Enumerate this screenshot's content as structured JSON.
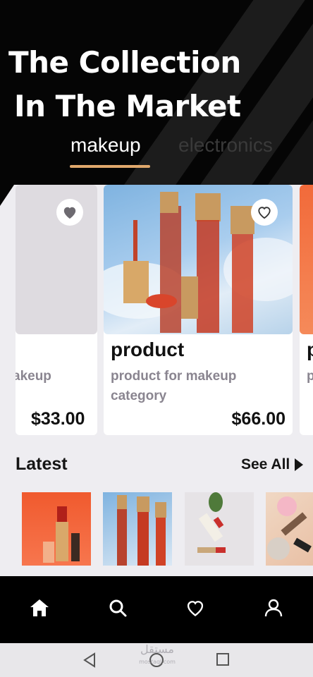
{
  "header": {
    "title_line1": "The Collection",
    "title_line2": "In The Market"
  },
  "tabs": [
    {
      "label": "makeup",
      "active": true
    },
    {
      "label": "electronics",
      "active": false
    }
  ],
  "products": [
    {
      "name": "",
      "description": "akeup",
      "price": "$33.00",
      "favorited": true
    },
    {
      "name": "product",
      "description": "product for makeup category",
      "price": "$66.00",
      "favorited": false
    },
    {
      "name": "p",
      "description": "p",
      "price": "",
      "favorited": false
    }
  ],
  "latest": {
    "title": "Latest",
    "see_all": "See All"
  },
  "bottom_nav": [
    "home-icon",
    "search-icon",
    "heart-icon",
    "user-icon"
  ],
  "watermark": {
    "arabic": "مستقل",
    "latin": "mostaql.com"
  },
  "colors": {
    "accent": "#e0a86c",
    "background": "#000000",
    "content_bg": "#eeedf1"
  }
}
